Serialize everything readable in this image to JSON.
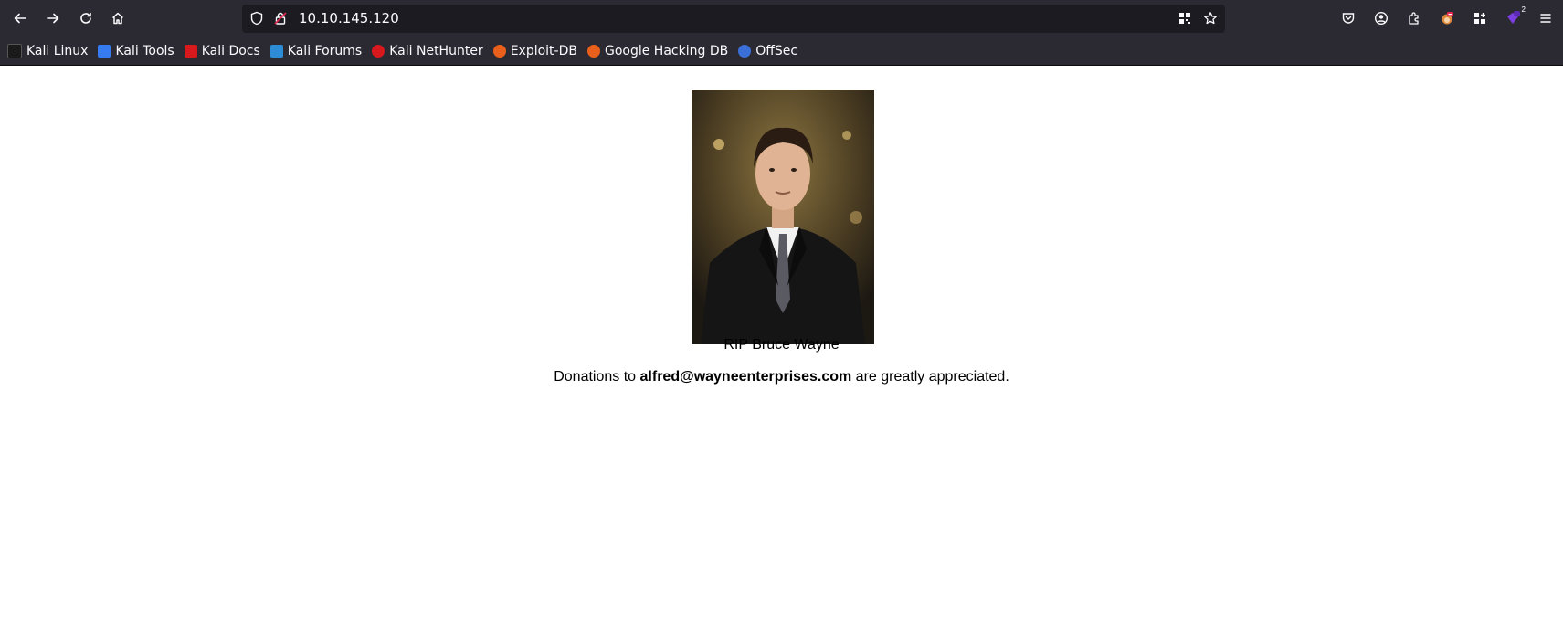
{
  "browser": {
    "url": "10.10.145.120",
    "bookmarks": [
      {
        "label": "Kali Linux",
        "color": "#1a1a1a"
      },
      {
        "label": "Kali Tools",
        "color": "#367bf0"
      },
      {
        "label": "Kali Docs",
        "color": "#d7191e"
      },
      {
        "label": "Kali Forums",
        "color": "#2e8bd6"
      },
      {
        "label": "Kali NetHunter",
        "color": "#d7191e"
      },
      {
        "label": "Exploit-DB",
        "color": "#e8601c"
      },
      {
        "label": "Google Hacking DB",
        "color": "#e8601c"
      },
      {
        "label": "OffSec",
        "color": "#3a6fd8"
      }
    ],
    "extension_badge": "2"
  },
  "page": {
    "photo_alt": "",
    "caption": "RIP Bruce Wayne",
    "donation_prefix": "Donations to",
    "donation_email": "alfred@wayneenterprises.com",
    "donation_suffix": "are greatly appreciated."
  }
}
